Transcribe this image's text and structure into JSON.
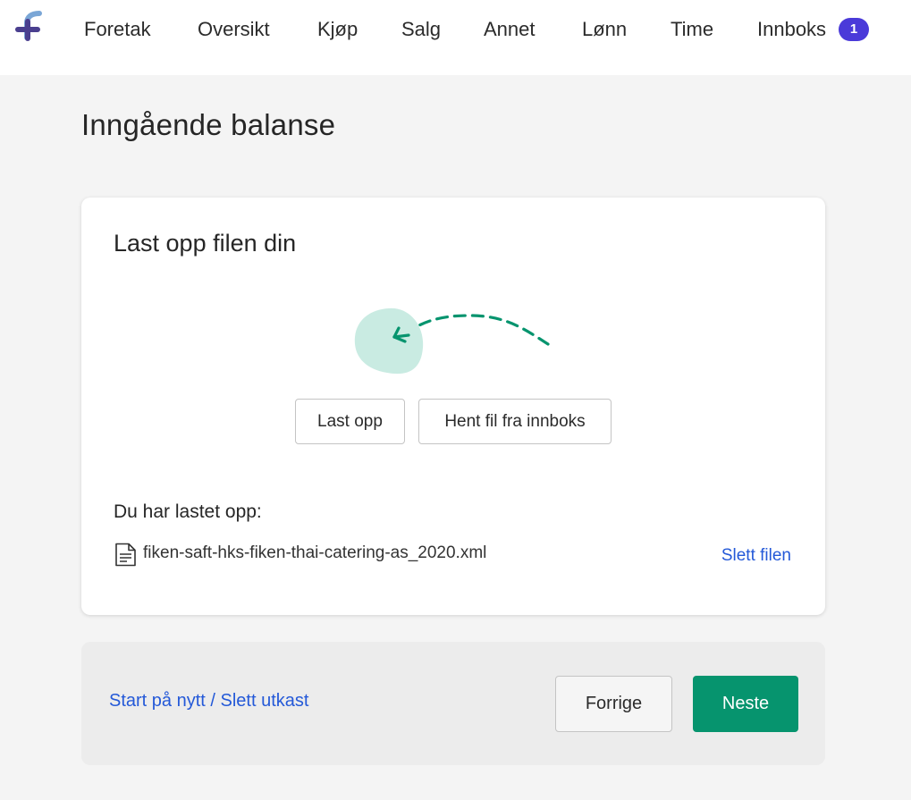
{
  "app": {
    "logo_icon": "fiken-logo-icon",
    "accent_color": "#4a3ad9",
    "link_color": "#2459d8",
    "primary_color": "#06946e"
  },
  "nav": {
    "items": [
      {
        "label": "Foretak"
      },
      {
        "label": "Oversikt"
      },
      {
        "label": "Kjøp"
      },
      {
        "label": "Salg"
      },
      {
        "label": "Annet"
      },
      {
        "label": "Lønn"
      },
      {
        "label": "Time"
      },
      {
        "label": "Innboks"
      }
    ],
    "inbox_badge": "1"
  },
  "page": {
    "title": "Inngående balanse"
  },
  "upload_card": {
    "title": "Last opp filen din",
    "illustration_icon": "upload-arrow-illustration",
    "upload_button": "Last opp",
    "fetch_button": "Hent fil fra innboks",
    "uploaded_label": "Du har lastet opp:",
    "file_icon": "document-icon",
    "file_name": "fiken-saft-hks-fiken-thai-catering-as_2020.xml",
    "delete_link": "Slett filen"
  },
  "footer": {
    "restart_link": "Start på nytt / Slett utkast",
    "prev_button": "Forrige",
    "next_button": "Neste"
  }
}
